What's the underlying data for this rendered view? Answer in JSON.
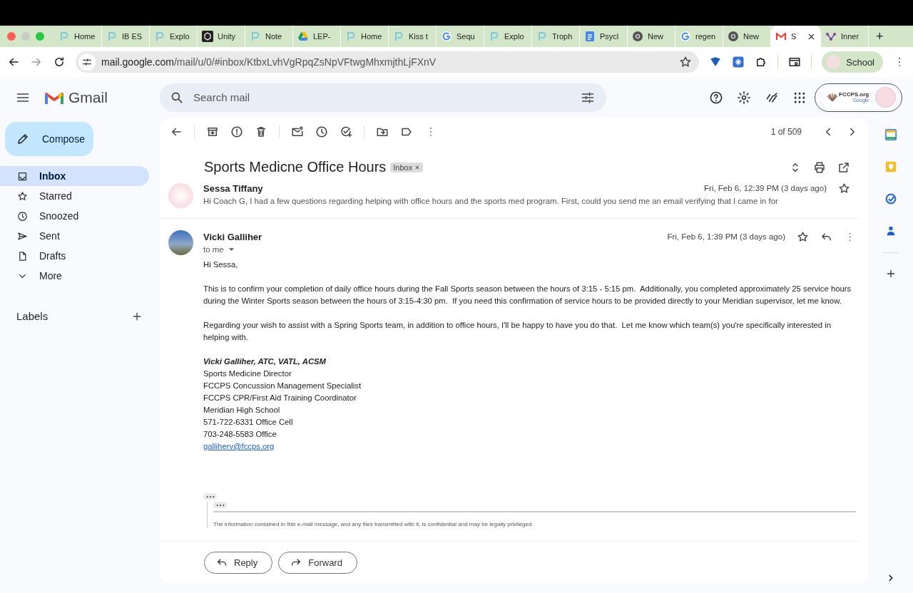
{
  "browser": {
    "tabs": [
      {
        "title": "Home",
        "kind": "p",
        "selected": false
      },
      {
        "title": "IB ES",
        "kind": "p",
        "selected": false
      },
      {
        "title": "Explo",
        "kind": "p",
        "selected": false
      },
      {
        "title": "Unity",
        "kind": "unity",
        "selected": false
      },
      {
        "title": "Note",
        "kind": "p",
        "selected": false
      },
      {
        "title": "LEP-",
        "kind": "drive",
        "selected": false
      },
      {
        "title": "Home",
        "kind": "p",
        "selected": false
      },
      {
        "title": "Kiss t",
        "kind": "p",
        "selected": false
      },
      {
        "title": "Sequ",
        "kind": "google",
        "selected": false
      },
      {
        "title": "Explo",
        "kind": "p",
        "selected": false
      },
      {
        "title": "Troph",
        "kind": "p",
        "selected": false
      },
      {
        "title": "Psycl",
        "kind": "docs",
        "selected": false
      },
      {
        "title": "New",
        "kind": "chrome",
        "selected": false
      },
      {
        "title": "regen",
        "kind": "google",
        "selected": false
      },
      {
        "title": "New",
        "kind": "chrome",
        "selected": false
      },
      {
        "title": "S",
        "kind": "gmail",
        "selected": true
      },
      {
        "title": "Inner",
        "kind": "purple",
        "selected": false
      }
    ],
    "new_tab": "+",
    "address": {
      "host": "mail.google.com",
      "path": "/mail/u/0/#inbox/KtbxLvhVgRpqZsNpVFtwgMhxmjthLjFXnV"
    },
    "profile": "School"
  },
  "gmail": {
    "logo": "Gmail",
    "search_placeholder": "Search mail",
    "compose": "Compose",
    "nav": [
      {
        "label": "Inbox",
        "kind": "inbox",
        "selected": true
      },
      {
        "label": "Starred",
        "kind": "star",
        "selected": false
      },
      {
        "label": "Snoozed",
        "kind": "clock",
        "selected": false
      },
      {
        "label": "Sent",
        "kind": "sent",
        "selected": false
      },
      {
        "label": "Drafts",
        "kind": "draft",
        "selected": false
      },
      {
        "label": "More",
        "kind": "chevron",
        "selected": false
      }
    ],
    "labels_heading": "Labels",
    "org_logo": [
      "FCCPS.org",
      "Google"
    ]
  },
  "toolbar": {
    "counter": "1 of 509"
  },
  "thread": {
    "subject": "Sports Medicne Office Hours",
    "label": "Inbox",
    "messages": [
      {
        "kind": "collapsed",
        "sender": "Sessa Tiffany",
        "date": "Fri, Feb 6, 12:39 PM (3 days ago)",
        "snippet": "Hi Coach G, I had a few questions regarding helping with office hours and the sports med program. First, could you send me an email verifying that I came in for"
      },
      {
        "kind": "expanded",
        "sender": "Vicki Galliher",
        "recipient": "to me",
        "date": "Fri, Feb 6, 1:39 PM (3 days ago)",
        "paragraphs": [
          "Hi Sessa,",
          "This is to confirm your completion of daily office hours during the Fall Sports season between the hours of 3:15 - 5:15 pm.  Additionally, you completed approximately 25 service hours during the Winter Sports season between the hours of 3:15-4:30 pm.  If you need this confirmation of service hours to be provided directly to your Meridian supervisor, let me know.",
          "Regarding your wish to assist with a Spring Sports team, in addition to office hours, I'll be happy to have you do that.  Let me know which team(s) you're specifically interested in helping with."
        ],
        "signature": {
          "name": "Vicki Galliher, ATC, VATL, ACSM",
          "lines": [
            "Sports Medicine Director",
            "FCCPS Concussion Management Specialist",
            "FCCPS CPR/First Aid Training Coordinator",
            "Meridian High School",
            "571-722-6331 Office Cell",
            "703-248-5583 Office"
          ],
          "email": "galliherv@fccps.org"
        },
        "disclaimer": "The information contained in this e-mail message, and any files transmitted with it, is confidential and may be legally privileged."
      }
    ]
  },
  "actions": [
    {
      "label": "Reply",
      "kind": "reply"
    },
    {
      "label": "Forward",
      "kind": "forward"
    }
  ]
}
